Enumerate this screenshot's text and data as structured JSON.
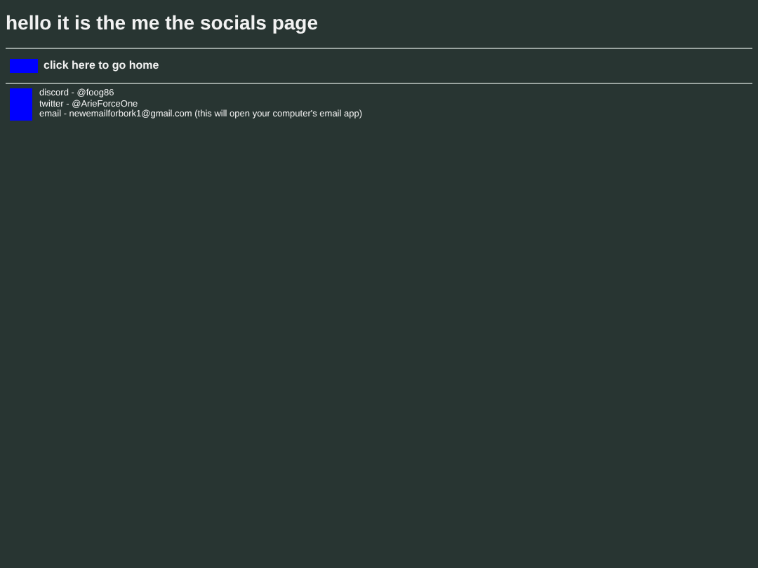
{
  "title": "hello it is the me the socials page",
  "home_link": "click here to go home",
  "socials": [
    "discord - @foog86",
    "twitter - @ArieForceOne",
    "email - newemailforbork1@gmail.com (this will open your computer's email app)"
  ]
}
